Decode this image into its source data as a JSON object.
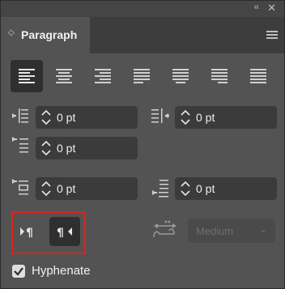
{
  "titlebar": {
    "collapse_glyph": "‹‹",
    "close_glyph": "✕"
  },
  "tab": {
    "label": "Paragraph",
    "arrows_glyph": "◇"
  },
  "alignment": {
    "buttons": [
      {
        "name": "align-left",
        "active": true
      },
      {
        "name": "align-center",
        "active": false
      },
      {
        "name": "align-right",
        "active": false
      },
      {
        "name": "justify-last-left",
        "active": false
      },
      {
        "name": "justify-last-center",
        "active": false
      },
      {
        "name": "justify-last-right",
        "active": false
      },
      {
        "name": "justify-all",
        "active": false
      }
    ]
  },
  "fields": {
    "left_indent": "0 pt",
    "right_indent": "0 pt",
    "first_line_indent": "0 pt",
    "space_before": "0 pt",
    "space_after": "0 pt"
  },
  "direction": {
    "ltr_glyph": "▸¶",
    "rtl_glyph": "¶◂",
    "active": "rtl"
  },
  "kashida": {
    "dropdown_value": "Medium",
    "chevron": "⌄"
  },
  "hyphenate": {
    "label": "Hyphenate",
    "checked": true
  },
  "colors": {
    "panel": "#535353",
    "highlight": "#e0211a"
  }
}
